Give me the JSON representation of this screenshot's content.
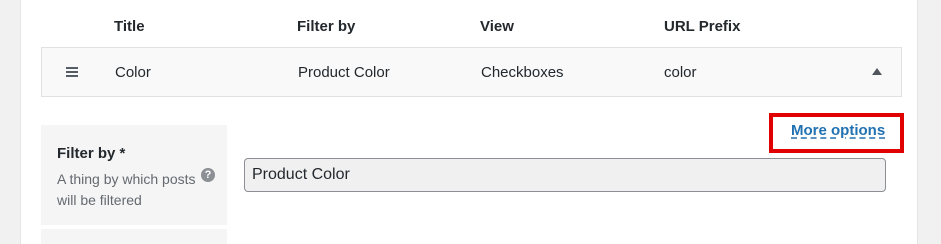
{
  "table": {
    "headers": {
      "title": "Title",
      "filter_by": "Filter by",
      "view": "View",
      "url_prefix": "URL Prefix"
    },
    "row": {
      "title": "Color",
      "filter_by": "Product Color",
      "view": "Checkboxes",
      "url_prefix": "color",
      "handle_icon": "drag-handle-icon",
      "toggle_icon": "triangle-up-icon"
    }
  },
  "form": {
    "more_options_label": "More options",
    "filter_by_field": {
      "label": "Filter by *",
      "description": "A thing by which posts will be filtered",
      "help_icon": "?",
      "value": "Product Color"
    }
  },
  "colors": {
    "link": "#2271b1",
    "highlight": "#e00000"
  }
}
